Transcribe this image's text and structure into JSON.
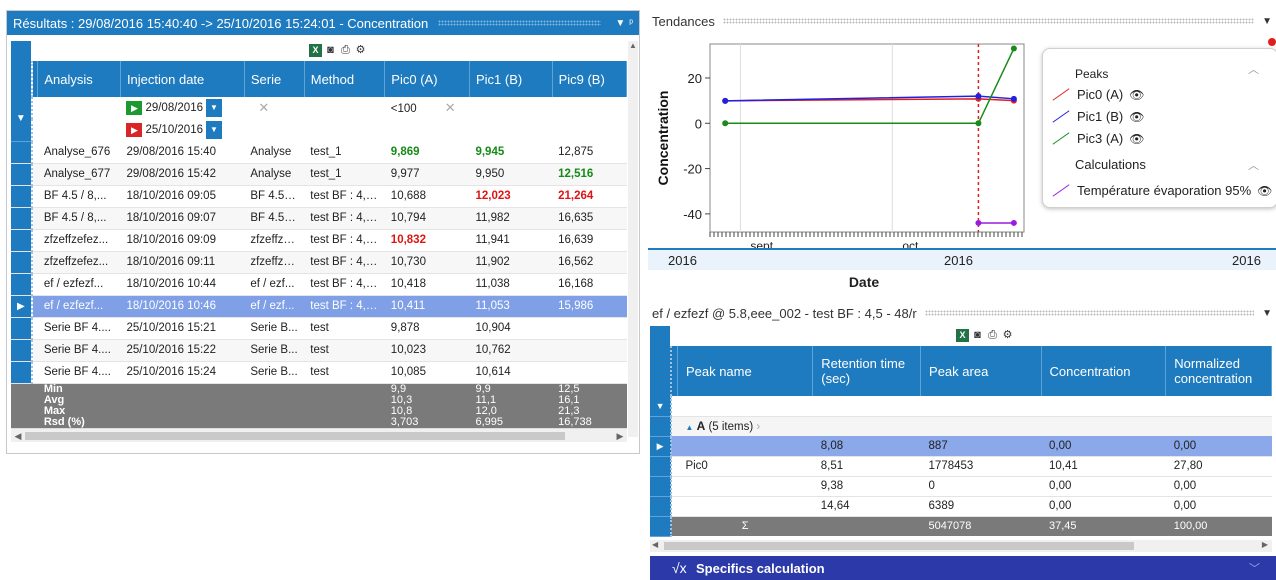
{
  "results_panel": {
    "title": "Résultats : 29/08/2016 15:40:40 -> 25/10/2016 15:24:01 - Concentration",
    "pin": "▾ ᵖ",
    "columns": [
      "Analysis",
      "Injection date",
      "Serie",
      "Method",
      "Pic0 (A)",
      "Pic1 (B)",
      "Pic9 (B)"
    ],
    "filter": {
      "date_from": "29/08/2016",
      "date_to": "25/10/2016",
      "pic0": "<100"
    },
    "rows": [
      {
        "analysis": "Analyse_676",
        "date": "29/08/2016 15:40",
        "serie": "Analyse",
        "method": "test_1",
        "pic0": "9,869",
        "pic1": "9,945",
        "pic9": "12,875"
      },
      {
        "analysis": "Analyse_677",
        "date": "29/08/2016 15:42",
        "serie": "Analyse",
        "method": "test_1",
        "pic0": "9,977",
        "pic1": "9,950",
        "pic9": "12,516"
      },
      {
        "analysis": "BF 4.5 / 8,...",
        "date": "18/10/2016 09:05",
        "serie": "BF 4.5 /...",
        "method": "test BF : 4,5...",
        "pic0": "10,688",
        "pic1": "12,023",
        "pic9": "21,264"
      },
      {
        "analysis": "BF 4.5 / 8,...",
        "date": "18/10/2016 09:07",
        "serie": "BF 4.5 /...",
        "method": "test BF : 4,5...",
        "pic0": "10,794",
        "pic1": "11,982",
        "pic9": "16,635"
      },
      {
        "analysis": "zfzeffzefez...",
        "date": "18/10/2016 09:09",
        "serie": "zfzeffze...",
        "method": "test BF : 4,5...",
        "pic0": "10,832",
        "pic1": "11,941",
        "pic9": "16,639"
      },
      {
        "analysis": "zfzeffzefez...",
        "date": "18/10/2016 09:11",
        "serie": "zfzeffze...",
        "method": "test BF : 4,5...",
        "pic0": "10,730",
        "pic1": "11,902",
        "pic9": "16,562"
      },
      {
        "analysis": "ef / ezfezf...",
        "date": "18/10/2016 10:44",
        "serie": "ef / ezf...",
        "method": "test BF : 4,5...",
        "pic0": "10,418",
        "pic1": "11,038",
        "pic9": "16,168"
      },
      {
        "analysis": "ef / ezfezf...",
        "date": "18/10/2016 10:46",
        "serie": "ef / ezf...",
        "method": "test BF : 4,5...",
        "pic0": "10,411",
        "pic1": "11,053",
        "pic9": "15,986"
      },
      {
        "analysis": "Serie BF 4....",
        "date": "25/10/2016 15:21",
        "serie": "Serie B...",
        "method": "test",
        "pic0": "9,878",
        "pic1": "10,904",
        "pic9": ""
      },
      {
        "analysis": "Serie BF 4....",
        "date": "25/10/2016 15:22",
        "serie": "Serie B...",
        "method": "test",
        "pic0": "10,023",
        "pic1": "10,762",
        "pic9": ""
      },
      {
        "analysis": "Serie BF 4....",
        "date": "25/10/2016 15:24",
        "serie": "Serie B...",
        "method": "test",
        "pic0": "10,085",
        "pic1": "10,614",
        "pic9": ""
      }
    ],
    "stats": [
      {
        "label": "Min",
        "pic0": "9,9",
        "pic1": "9,9",
        "pic9": "12,5"
      },
      {
        "label": "Avg",
        "pic0": "10,3",
        "pic1": "11,1",
        "pic9": "16,1"
      },
      {
        "label": "Max",
        "pic0": "10,8",
        "pic1": "12,0",
        "pic9": "21,3"
      },
      {
        "label": "Rsd (%)",
        "pic0": "3,703",
        "pic1": "6,995",
        "pic9": "16,738"
      }
    ]
  },
  "trend_panel": {
    "title": "Tendances",
    "ylabel": "Concentration",
    "xlabel": "Date",
    "month_ticks": [
      "sept.",
      "oct."
    ],
    "year_band": [
      "2016",
      "2016",
      "2016"
    ],
    "legend": {
      "peaks_header": "Peaks",
      "calc_header": "Calculations",
      "items": [
        {
          "label": "Pic0 (A)",
          "color": "#e02020"
        },
        {
          "label": "Pic1 (B)",
          "color": "#2020e0"
        },
        {
          "label": "Pic3 (A)",
          "color": "#1a8a1a"
        },
        {
          "label": "Température évaporation 95%",
          "color": "#9a1ae0"
        }
      ]
    }
  },
  "chart_data": {
    "type": "line",
    "ylabel": "Concentration",
    "xlabel": "Date",
    "ylim": [
      -48,
      35
    ],
    "yticks": [
      20,
      0,
      -20,
      -40
    ],
    "x": [
      "29/08/2016",
      "18/10/2016",
      "25/10/2016"
    ],
    "series": [
      {
        "name": "Pic0 (A)",
        "values": [
          9.9,
          10.8,
          10.0
        ]
      },
      {
        "name": "Pic1 (B)",
        "values": [
          9.9,
          12.0,
          10.8
        ]
      },
      {
        "name": "Pic3 (A)",
        "values": [
          0,
          0,
          33
        ]
      },
      {
        "name": "Température évaporation 95%",
        "values": [
          null,
          -44,
          -44
        ]
      }
    ]
  },
  "peak_panel": {
    "title": "ef / ezfezf @ 5.8,eee_002 - test BF : 4,5 - 48/r",
    "columns": [
      "Peak name",
      "Retention time (sec)",
      "Peak area",
      "Concentration",
      "Normalized concentration"
    ],
    "group_label": "A",
    "group_count": "(5 items)",
    "rows": [
      {
        "name": "",
        "rt": "8,08",
        "area": "887",
        "conc": "0,00",
        "norm": "0,00"
      },
      {
        "name": "Pic0",
        "rt": "8,51",
        "area": "1778453",
        "conc": "10,41",
        "norm": "27,80"
      },
      {
        "name": "",
        "rt": "9,38",
        "area": "0",
        "conc": "0,00",
        "norm": "0,00"
      },
      {
        "name": "",
        "rt": "14,64",
        "area": "6389",
        "conc": "0,00",
        "norm": "0,00"
      }
    ],
    "sum": {
      "symbol": "Σ",
      "area": "5047078",
      "conc": "37,45",
      "norm": "100,00"
    }
  },
  "specifics_bar": {
    "label": "Specifics calculation"
  }
}
